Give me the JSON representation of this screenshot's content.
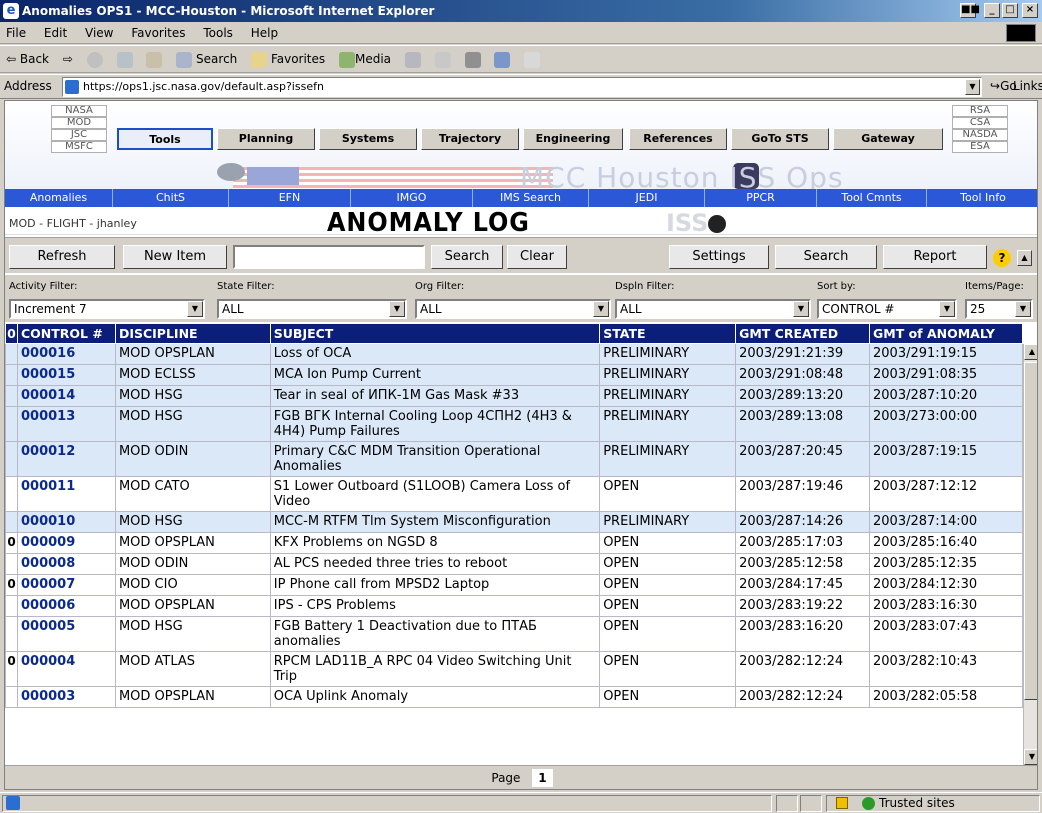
{
  "window": {
    "title": "Anomalies OPS1 - MCC-Houston - Microsoft Internet Explorer",
    "controls": [
      "■■",
      "_",
      "□",
      "×"
    ]
  },
  "menu": [
    "File",
    "Edit",
    "View",
    "Favorites",
    "Tools",
    "Help"
  ],
  "toolbar": {
    "back": "⇦ Back",
    "forward": "⇨",
    "search": "Search",
    "favorites": "Favorites",
    "media": "Media"
  },
  "address": {
    "label": "Address",
    "url": "https://ops1.jsc.nasa.gov/default.asp?issefn",
    "go": "Go",
    "links": "Links"
  },
  "banner": {
    "agencies_left": [
      "NASA",
      "MOD",
      "JSC",
      "MSFC"
    ],
    "agencies_right": [
      "RSA",
      "CSA",
      "NASDA",
      "ESA"
    ],
    "nav": [
      "Tools",
      "Planning",
      "Systems",
      "Trajectory",
      "Engineering",
      "References",
      "GoTo STS",
      "Gateway"
    ],
    "active_nav": "Tools",
    "watermark": "MCC Houston ISS Ops"
  },
  "bluebar": [
    "Anomalies",
    "ChitS",
    "EFN",
    "IMGO",
    "IMS Search",
    "JEDI",
    "PPCR",
    "Tool Cmnts",
    "Tool Info"
  ],
  "header": {
    "user": "MOD - FLIGHT - jhanley",
    "title": "ANOMALY LOG",
    "logo": "ISS"
  },
  "buttons": {
    "refresh": "Refresh",
    "new_item": "New Item",
    "search": "Search",
    "clear": "Clear",
    "settings": "Settings",
    "search2": "Search",
    "report": "Report",
    "help": "?"
  },
  "filters": {
    "activity": {
      "label": "Activity Filter:",
      "value": "Increment 7"
    },
    "state": {
      "label": "State Filter:",
      "value": "ALL"
    },
    "org": {
      "label": "Org Filter:",
      "value": "ALL"
    },
    "dspln": {
      "label": "Dspln Filter:",
      "value": "ALL"
    },
    "sort": {
      "label": "Sort by:",
      "value": "CONTROL #"
    },
    "items": {
      "label": "Items/Page:",
      "value": "25"
    }
  },
  "table": {
    "clip_header": "0",
    "columns": [
      "CONTROL #",
      "DISCIPLINE",
      "SUBJECT",
      "STATE",
      "GMT CREATED",
      "GMT of ANOMALY"
    ],
    "rows": [
      {
        "clip": "",
        "control": "000016",
        "discipline": "MOD OPSPLAN",
        "subject": "Loss of OCA",
        "state": "PRELIMINARY",
        "created": "2003/291:21:39",
        "anomaly": "2003/291:19:15"
      },
      {
        "clip": "",
        "control": "000015",
        "discipline": "MOD ECLSS",
        "subject": "MCA Ion Pump Current",
        "state": "PRELIMINARY",
        "created": "2003/291:08:48",
        "anomaly": "2003/291:08:35"
      },
      {
        "clip": "",
        "control": "000014",
        "discipline": "MOD HSG",
        "subject": "Tear in seal of ИПК-1M Gas Mask #33",
        "state": "PRELIMINARY",
        "created": "2003/289:13:20",
        "anomaly": "2003/287:10:20"
      },
      {
        "clip": "",
        "control": "000013",
        "discipline": "MOD HSG",
        "subject": "FGB ВГК Internal Cooling Loop 4СПН2 (4H3 & 4H4) Pump Failures",
        "state": "PRELIMINARY",
        "created": "2003/289:13:08",
        "anomaly": "2003/273:00:00"
      },
      {
        "clip": "",
        "control": "000012",
        "discipline": "MOD ODIN",
        "subject": "Primary C&C MDM Transition Operational Anomalies",
        "state": "PRELIMINARY",
        "created": "2003/287:20:45",
        "anomaly": "2003/287:19:15"
      },
      {
        "clip": "",
        "control": "000011",
        "discipline": "MOD CATO",
        "subject": "S1 Lower Outboard (S1LOOB) Camera Loss of Video",
        "state": "OPEN",
        "created": "2003/287:19:46",
        "anomaly": "2003/287:12:12"
      },
      {
        "clip": "",
        "control": "000010",
        "discipline": "MOD HSG",
        "subject": "MCC-M RTFM Tlm System Misconfiguration",
        "state": "PRELIMINARY",
        "created": "2003/287:14:26",
        "anomaly": "2003/287:14:00"
      },
      {
        "clip": "0",
        "control": "000009",
        "discipline": "MOD OPSPLAN",
        "subject": "KFX Problems on NGSD 8",
        "state": "OPEN",
        "created": "2003/285:17:03",
        "anomaly": "2003/285:16:40"
      },
      {
        "clip": "",
        "control": "000008",
        "discipline": "MOD ODIN",
        "subject": "AL PCS needed three tries to reboot",
        "state": "OPEN",
        "created": "2003/285:12:58",
        "anomaly": "2003/285:12:35"
      },
      {
        "clip": "0",
        "control": "000007",
        "discipline": "MOD CIO",
        "subject": "IP Phone call from MPSD2 Laptop",
        "state": "OPEN",
        "created": "2003/284:17:45",
        "anomaly": "2003/284:12:30"
      },
      {
        "clip": "",
        "control": "000006",
        "discipline": "MOD OPSPLAN",
        "subject": "IPS - CPS Problems",
        "state": "OPEN",
        "created": "2003/283:19:22",
        "anomaly": "2003/283:16:30"
      },
      {
        "clip": "",
        "control": "000005",
        "discipline": "MOD HSG",
        "subject": "FGB Battery 1 Deactivation due to ПТАБ anomalies",
        "state": "OPEN",
        "created": "2003/283:16:20",
        "anomaly": "2003/283:07:43"
      },
      {
        "clip": "0",
        "control": "000004",
        "discipline": "MOD ATLAS",
        "subject": "RPCM LAD11B_A RPC 04 Video Switching Unit Trip",
        "state": "OPEN",
        "created": "2003/282:12:24",
        "anomaly": "2003/282:10:43"
      },
      {
        "clip": "",
        "control": "000003",
        "discipline": "MOD OPSPLAN",
        "subject": "OCA Uplink Anomaly",
        "state": "OPEN",
        "created": "2003/282:12:24",
        "anomaly": "2003/282:05:58"
      }
    ]
  },
  "pager": {
    "label": "Page",
    "current": "1"
  },
  "status": {
    "zone": "Trusted sites"
  }
}
